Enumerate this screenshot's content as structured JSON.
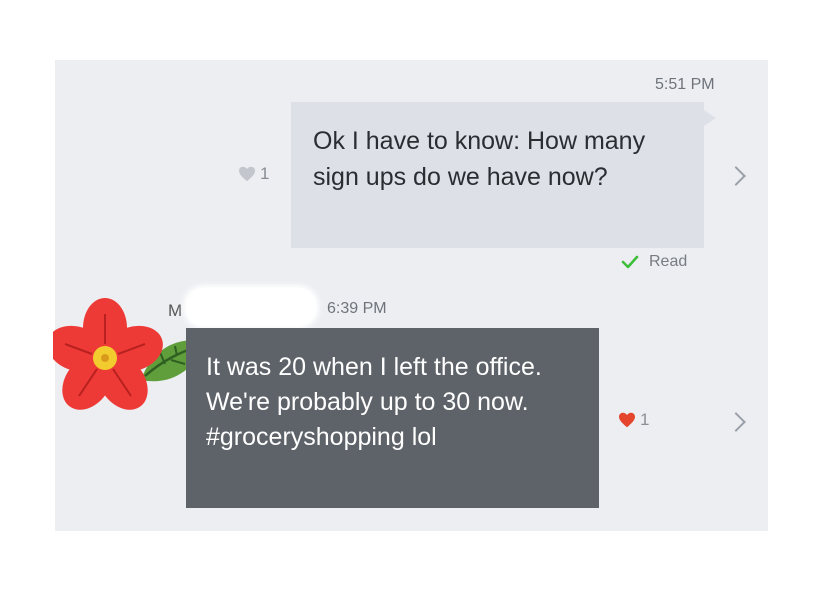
{
  "conversation": {
    "outgoing": {
      "timestamp": "5:51 PM",
      "text": "Ok I have to know: How many sign ups do we have now?",
      "like_count": "1",
      "read_status": "Read"
    },
    "incoming": {
      "sender_initial": "M",
      "timestamp": "6:39 PM",
      "text": "It was 20 when I left the office. We're probably up to 30 now. #groceryshopping lol",
      "like_count": "1"
    }
  },
  "icons": {
    "outgoing_like": "heart-icon",
    "incoming_like": "heart-icon",
    "read_check": "check-icon",
    "chevrons": "chevron-right-icon",
    "avatar": "flower-avatar"
  },
  "colors": {
    "panel_bg": "#eceef2",
    "outgoing_bubble": "#dde1e7",
    "incoming_bubble": "#5e6369",
    "liked_heart": "#e5452d",
    "unliked_heart": "#c3c7cd",
    "read_check": "#3ebf3a"
  }
}
